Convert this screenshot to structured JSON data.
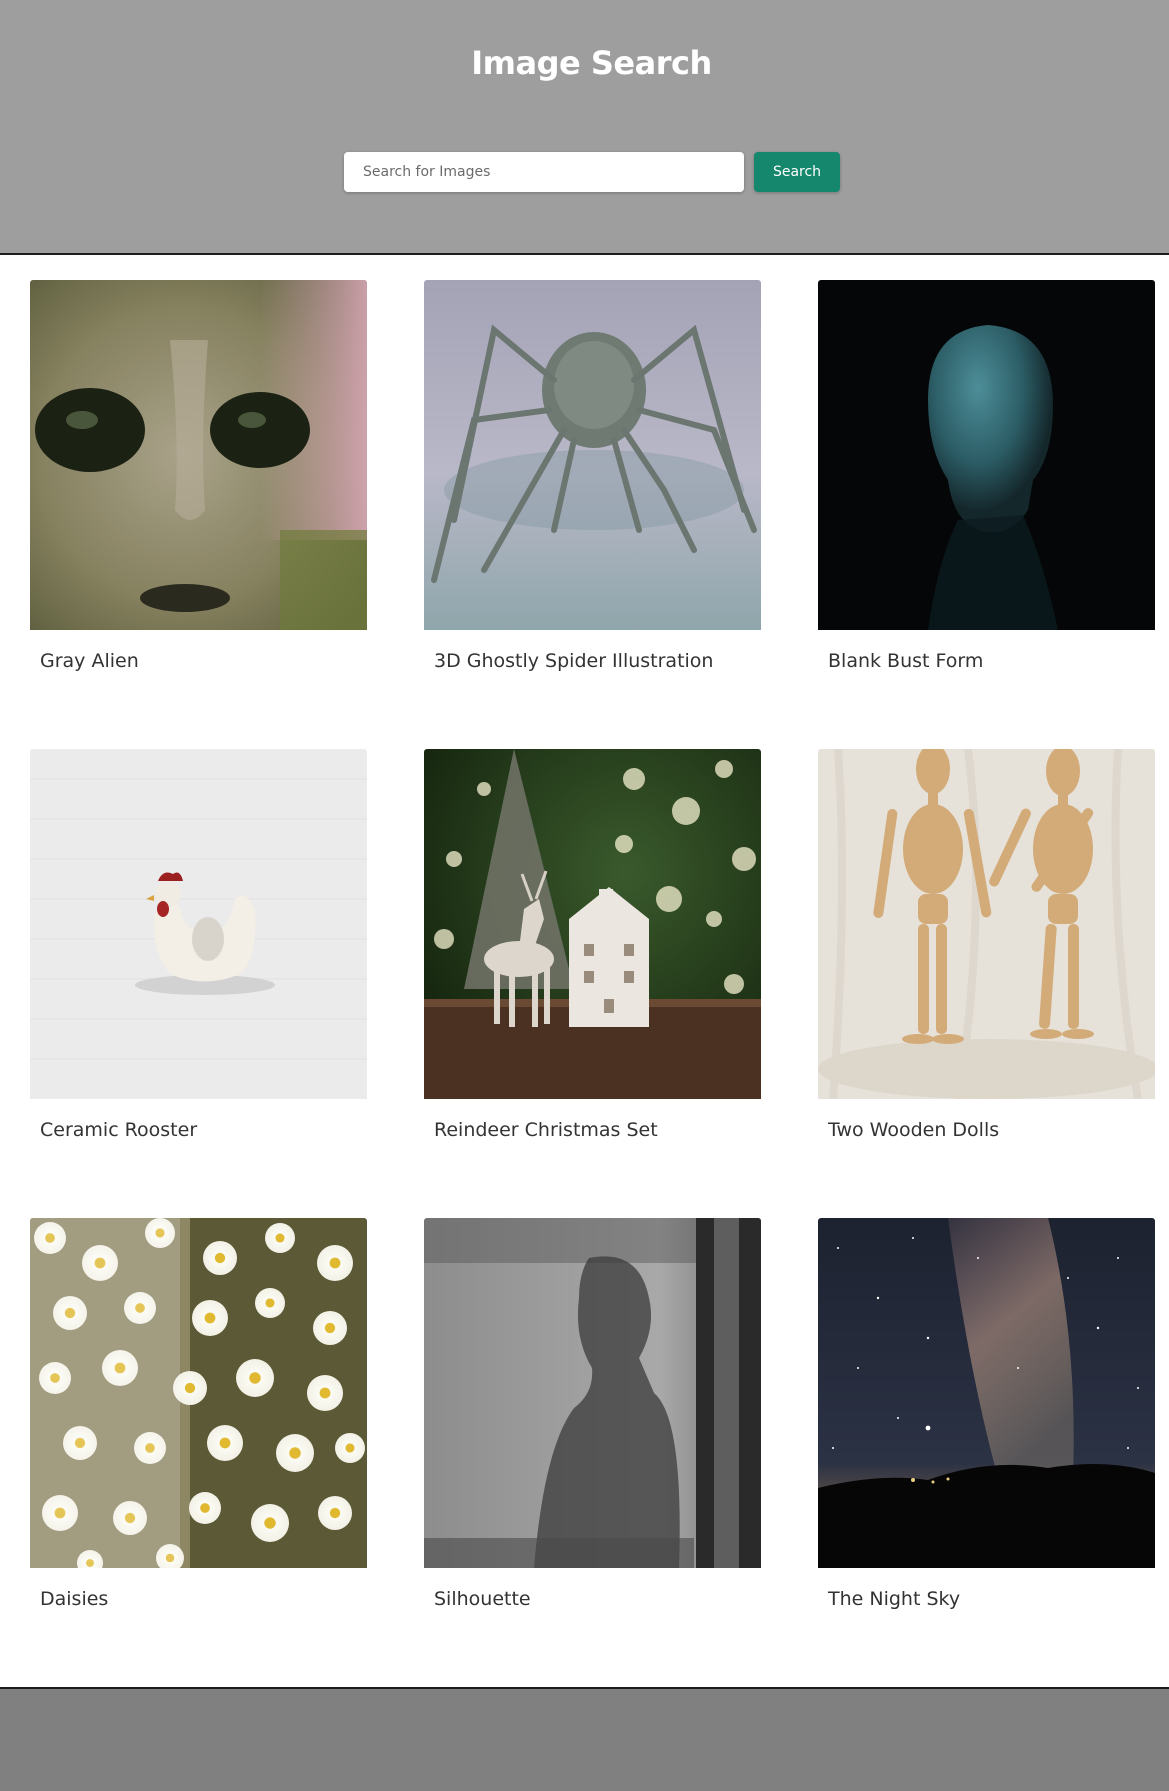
{
  "header": {
    "title": "Image Search",
    "search": {
      "placeholder": "Search for Images",
      "value": "",
      "button_label": "Search"
    }
  },
  "results": [
    {
      "caption": "Gray Alien"
    },
    {
      "caption": "3D Ghostly Spider Illustration"
    },
    {
      "caption": "Blank Bust Form"
    },
    {
      "caption": "Ceramic Rooster"
    },
    {
      "caption": "Reindeer Christmas Set"
    },
    {
      "caption": "Two Wooden Dolls"
    },
    {
      "caption": "Daisies"
    },
    {
      "caption": "Silhouette"
    },
    {
      "caption": "The Night Sky"
    }
  ],
  "colors": {
    "header_bg": "#9e9e9e",
    "footer_bg": "#808080",
    "accent": "#15876c",
    "title_text": "#ffffff",
    "caption_text": "#333333"
  }
}
